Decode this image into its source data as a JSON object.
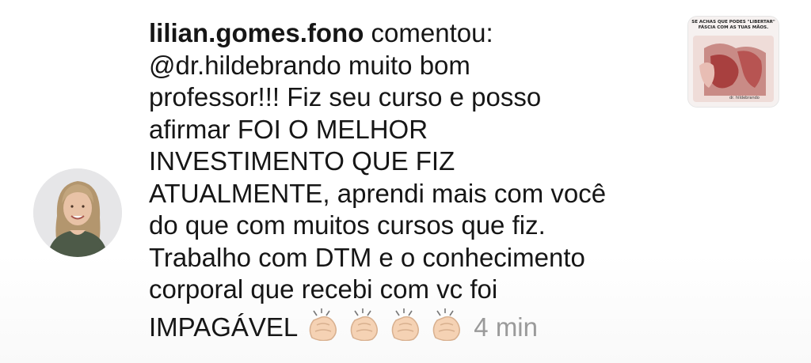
{
  "comment": {
    "username": "lilian.gomes.fono",
    "action": "comentou:",
    "lines": [
      "@dr.hildebrando muito bom",
      "professor!!! Fiz seu curso e posso",
      "afirmar FOI O MELHOR",
      "INVESTIMENTO QUE FIZ",
      "ATUALMENTE, aprendi mais com você",
      "do que com muitos cursos que fiz.",
      "Trabalho com DTM e o conhecimento",
      "corporal que recebi com vc foi"
    ],
    "last_line": "IMPAGÁVEL",
    "emoji": [
      "clapping-hands",
      "clapping-hands",
      "clapping-hands",
      "clapping-hands"
    ],
    "timestamp": "4 min"
  },
  "post_thumbnail": {
    "caption": "SE ACHAS QUE PODES \"LIBERTAR\" FÁSCIA COM AS TUAS MÃOS."
  },
  "colors": {
    "text": "#161616",
    "timestamp": "#9a9a9a",
    "background": "#ffffff"
  }
}
